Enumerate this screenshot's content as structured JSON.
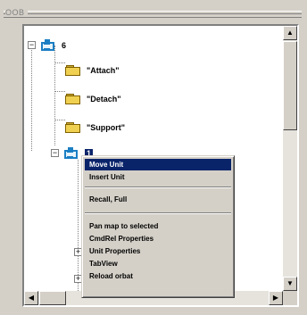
{
  "window": {
    "title": "OOB"
  },
  "tree": {
    "root": {
      "label": "6",
      "expander": "−"
    },
    "folders": [
      "\"Attach\"",
      "\"Detach\"",
      "\"Support\""
    ],
    "selected": {
      "label": "1",
      "expander": "−"
    },
    "collapsed_expander": "+"
  },
  "context_menu": {
    "items": [
      "Move Unit",
      "Insert Unit",
      "Recall, Full",
      "Pan map to selected",
      "CmdRel Properties",
      "Unit Properties",
      "TabView",
      "Reload orbat"
    ],
    "highlighted_index": 0
  },
  "scrollbar": {
    "up": "▲",
    "down": "▼",
    "left": "◀",
    "right": "▶"
  },
  "colors": {
    "selection": "#0a246a",
    "unit_icon": "#1b7fc4",
    "folder": "#f0d050"
  }
}
